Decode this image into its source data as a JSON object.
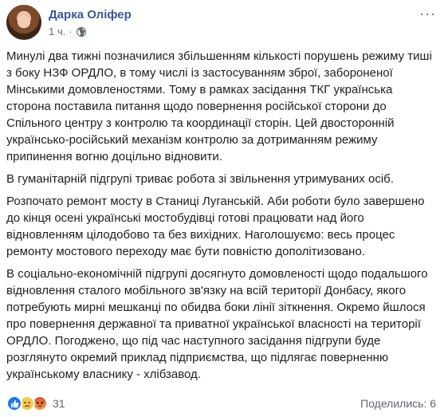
{
  "post": {
    "author": "Дарка Оліфер",
    "time": "1 ч.",
    "separator": "·",
    "icons": {
      "privacy": "globe-icon",
      "more": "more-options-icon"
    },
    "paragraphs": [
      "Минулі два тижні позначилися збільшенням кількості порушень режиму тиші з боку НЗФ ОРДЛО, в тому числі із застосуванням зброї, забороненої Мінськими домовленостями. Тому в рамках засідання ТКГ українська сторона поставила питання щодо повернення російської сторони до Спільного центру з контролю та координації сторін. Цей двосторонній українсько-російський механізм контролю за дотриманням режиму припинення вогню доцільно відновити.",
      "В гуманітарній підгрупі триває робота зі звільнення утримуваних осіб.",
      "Розпочато ремонт мосту в Станиці Луганській. Аби роботи було завершено до кінця осені українські мостобудівці готові працювати над його відновленням цілодобово та без вихідних. Наголошуємо: весь процес ремонту мостового переходу має бути повністю дополітизовано.",
      "В соціально-економічній підгрупі досягнуто домовленості щодо подальшого відновлення сталого мобільного зв'язку на всій території Донбасу, якого потребують мирні мешканці по обидва боки лінії зіткнення. Окремо йшлося про повернення державної та приватної української власності на території ОРДЛО. Погоджено, що під час наступного засідання підгрупи буде розглянуто окремий приклад підприємства, що підлягає поверненню українському власнику - хлібзавод."
    ],
    "reactions": {
      "types": [
        "like-icon",
        "sad-icon",
        "angry-icon"
      ],
      "count": "31"
    },
    "shares": "Поделились: 6",
    "colors": {
      "author": "#385898",
      "meta": "#606770",
      "text": "#1c1e21",
      "like": "#1877f2"
    }
  }
}
